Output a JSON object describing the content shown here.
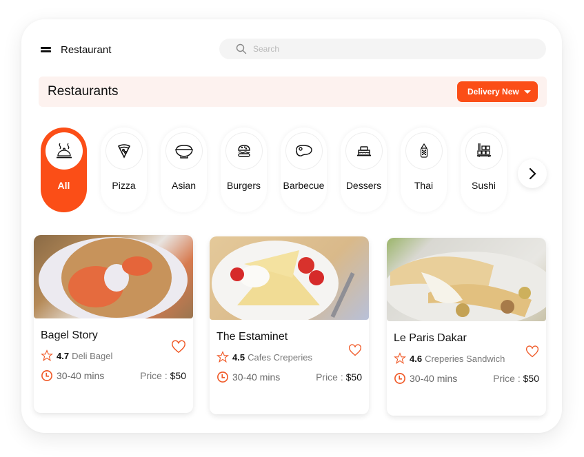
{
  "header": {
    "app_title": "Restaurant",
    "search_placeholder": "Search"
  },
  "banner": {
    "title": "Restaurants",
    "delivery_label": "Delivery New"
  },
  "colors": {
    "accent": "#fb4e17",
    "banner_bg": "#fdf2ef"
  },
  "categories": [
    {
      "label": "All",
      "icon": "cloche-icon",
      "active": true
    },
    {
      "label": "Pizza",
      "icon": "pizza-icon",
      "active": false
    },
    {
      "label": "Asian",
      "icon": "rice-bowl-icon",
      "active": false
    },
    {
      "label": "Burgers",
      "icon": "burger-icon",
      "active": false
    },
    {
      "label": "Barbecue",
      "icon": "steak-icon",
      "active": false
    },
    {
      "label": "Dessers",
      "icon": "cake-icon",
      "active": false
    },
    {
      "label": "Thai",
      "icon": "thai-dish-icon",
      "active": false
    },
    {
      "label": "Sushi",
      "icon": "sushi-icon",
      "active": false
    }
  ],
  "restaurants": [
    {
      "name": "Bagel Story",
      "rating": "4.7",
      "tags": "Deli Bagel",
      "time": "30-40 mins",
      "price_label": "Price : ",
      "price": "$50",
      "image": "bagel-photo"
    },
    {
      "name": "The Estaminet",
      "rating": "4.5",
      "tags": "Cafes Creperies",
      "time": "30-40 mins",
      "price_label": "Price : ",
      "price": "$50",
      "image": "crepes-strawberry-photo"
    },
    {
      "name": "Le Paris Dakar",
      "rating": "4.6",
      "tags": "Creperies Sandwich",
      "time": "30-40 mins",
      "price_label": "Price : ",
      "price": "$50",
      "image": "crepes-rolled-photo"
    }
  ]
}
